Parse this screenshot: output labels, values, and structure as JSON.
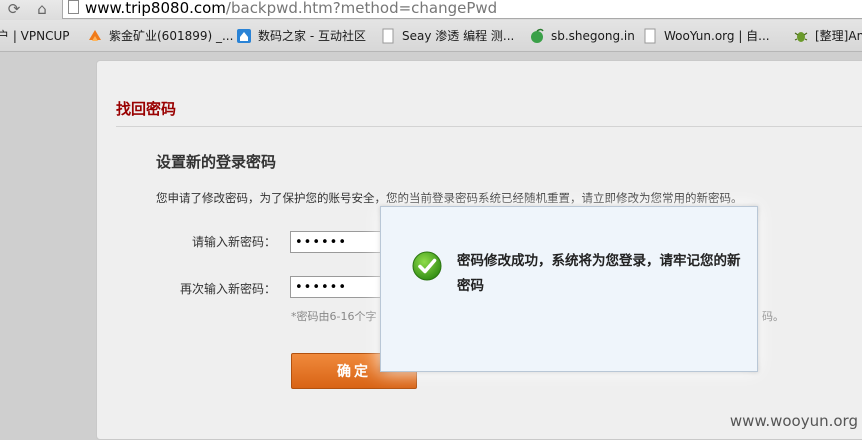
{
  "browser": {
    "url_host": "www.trip8080.com",
    "url_path": "/backpwd.htm?method=changePwd",
    "bookmarks": [
      {
        "label": "户 | VPNCUP",
        "icon": "bookmark-icon"
      },
      {
        "label": "紫金矿业(601899) _...",
        "icon": "stock-icon"
      },
      {
        "label": "数码之家 - 互动社区",
        "icon": "home-icon"
      },
      {
        "label": "Seay 渗透 编程 测...",
        "icon": "page-icon"
      },
      {
        "label": "sb.shegong.in",
        "icon": "leaf-icon"
      },
      {
        "label": "WooYun.org | 自...",
        "icon": "page-icon"
      },
      {
        "label": "[整理]An",
        "icon": "bug-icon"
      }
    ]
  },
  "page": {
    "section_title": "找回密码",
    "form_heading": "设置新的登录密码",
    "notice": "您申请了修改密码，为了保护您的账号安全，您的当前登录密码系统已经随机重置，请立即修改为您常用的新密码。",
    "new_password_label": "请输入新密码：",
    "new_password_value": "••••••",
    "confirm_password_label": "再次输入新密码：",
    "confirm_password_value": "••••••",
    "hint": "*密码由6-16个字",
    "hint_tail": "码。",
    "confirm_button": "确定"
  },
  "modal": {
    "message": "密码修改成功，系统将为您登录，请牢记您的新密码",
    "icon": "success-check-icon"
  },
  "watermark": "www.wooyun.org"
}
